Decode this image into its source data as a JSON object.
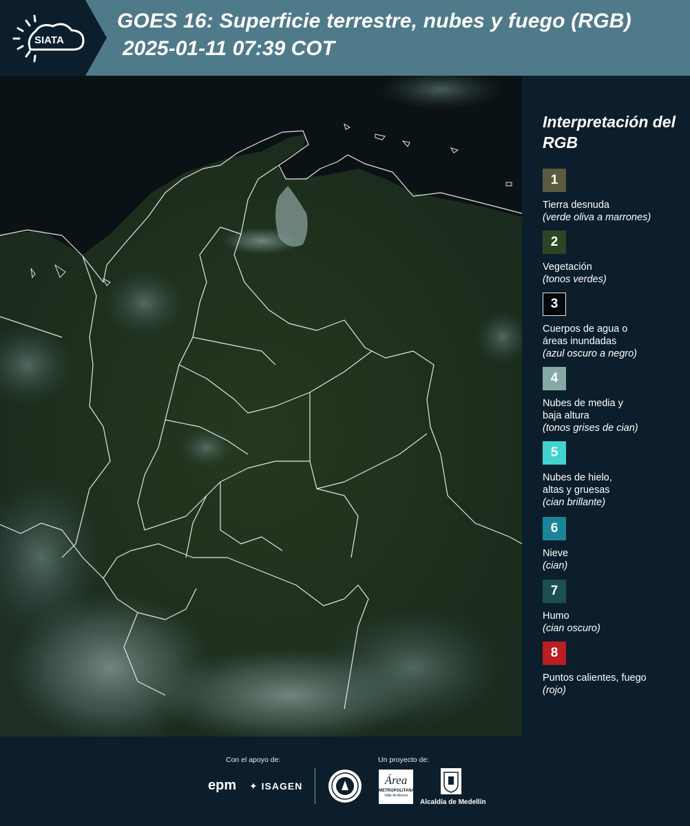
{
  "header": {
    "logo_text": "SIATA",
    "title_line1": "GOES 16: Superficie terrestre, nubes y fuego (RGB)",
    "title_line2": "2025-01-11 07:39 COT"
  },
  "legend": {
    "title": "Interpretación del RGB",
    "items": [
      {
        "number": "1",
        "label": "Tierra desnuda",
        "desc": "(verde oliva a marrones)",
        "color": "#5c5b3f"
      },
      {
        "number": "2",
        "label": "Vegetación",
        "desc": "(tonos verdes)",
        "color": "#2c4625"
      },
      {
        "number": "3",
        "label": "Cuerpos de agua o\náreas inundadas",
        "desc": "(azul oscuro a negro)",
        "color": "#05080a"
      },
      {
        "number": "4",
        "label": "Nubes de media y\nbaja altura",
        "desc": "(tonos grises de cian)",
        "color": "#86a9a5"
      },
      {
        "number": "5",
        "label": "Nubes de hielo,\naltas y gruesas",
        "desc": "(cian brillante)",
        "color": "#3fd4cf"
      },
      {
        "number": "6",
        "label": "Nieve",
        "desc": "(cian)",
        "color": "#1a8598"
      },
      {
        "number": "7",
        "label": "Humo",
        "desc": "(cian oscuro)",
        "color": "#1b4f52"
      },
      {
        "number": "8",
        "label": "Puntos calientes, fuego",
        "desc": "(rojo)",
        "color": "#b81e22"
      }
    ]
  },
  "footer": {
    "support_label": "Con el apoyo de:",
    "project_label": "Un proyecto de:",
    "epm_logo": "epm",
    "isagen_logo": "ISAGEN",
    "area_logo_line1": "Área",
    "area_logo_line2": "METROPOLITANA",
    "area_logo_line3": "Valle de Aburrá",
    "alcaldia_logo": "Alcaldía de Medellín"
  },
  "colors": {
    "header_bg": "#4f7a8a",
    "panel_bg": "#0c1e2b",
    "border_line": "#e6e6e6"
  }
}
